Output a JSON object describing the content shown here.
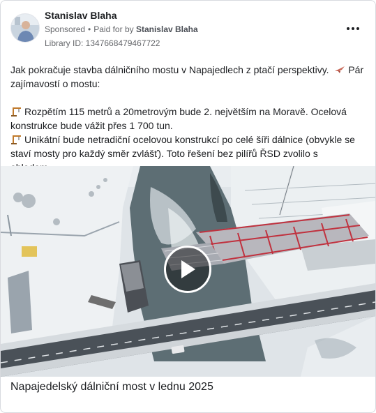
{
  "post": {
    "author": "Stanislav Blaha",
    "sponsored_label": "Sponsored",
    "separator": "•",
    "paid_for_prefix": "Paid for by",
    "paid_for_name": "Stanislav Blaha",
    "library_id": "Library ID: 1347668479467722",
    "more_icon": "more-horizontal-icon",
    "text_line1": "Jak pokračuje stavba dálničního mostu v Napajedlech z ptačí perspektivy.",
    "text_line1_tail": " Pár zajímavostí o mostu:",
    "fact1": "Rozpětím 115 metrů a 20metrovým bude 2. největším na Moravě. Ocelová konstrukce bude vážit přes 1 700 tun.",
    "fact2": "Unikátní bude netradiční ocelovou konstrukcí po celé šíři dálnice (obvykle se staví mosty pro každý směr zvlášť). Toto řešení bez pilířů ŘSD zvolilo s ohledem…",
    "emoji_bird": "bird-emoji-icon",
    "emoji_crane": "construction-crane-emoji-icon",
    "video_thumbnail": "aerial winter bridge construction",
    "play_icon": "play-icon",
    "caption": "Napajedelský dálniční most v lednu 2025"
  }
}
